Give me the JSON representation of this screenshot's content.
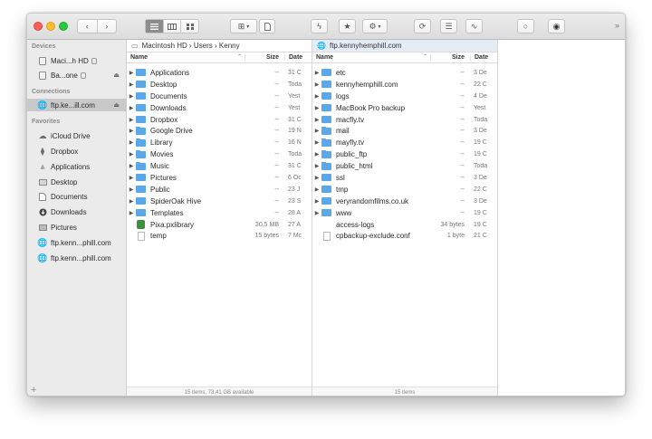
{
  "sidebar": {
    "sections": {
      "devices": "Devices",
      "connections": "Connections",
      "favorites": "Favorites"
    },
    "devices": [
      {
        "label": "Maci...h HD",
        "icon": "disk-icon"
      },
      {
        "label": "Ba...one",
        "icon": "disk-icon"
      }
    ],
    "connections": [
      {
        "label": "ftp.ke...ill.com",
        "icon": "globe-icon"
      }
    ],
    "favorites": [
      {
        "label": "iCloud Drive",
        "icon": "cloud-icon"
      },
      {
        "label": "Dropbox",
        "icon": "dropbox-icon"
      },
      {
        "label": "Applications",
        "icon": "applications-icon"
      },
      {
        "label": "Desktop",
        "icon": "desktop-icon"
      },
      {
        "label": "Documents",
        "icon": "documents-icon"
      },
      {
        "label": "Downloads",
        "icon": "downloads-icon"
      },
      {
        "label": "Pictures",
        "icon": "pictures-icon"
      },
      {
        "label": "ftp.kenn...phill.com",
        "icon": "globe-icon"
      },
      {
        "label": "ftp.kenn...phill.com",
        "icon": "globe-icon"
      }
    ],
    "add_label": "+"
  },
  "left_pane": {
    "path": "Macintosh HD › Users › Kenny",
    "columns": {
      "name": "Name",
      "size": "Size",
      "date": "Date"
    },
    "rows": [
      {
        "name": "Applications",
        "size": "--",
        "date": "31 C",
        "type": "folder"
      },
      {
        "name": "Desktop",
        "size": "--",
        "date": "Toda",
        "type": "folder"
      },
      {
        "name": "Documents",
        "size": "--",
        "date": "Yest",
        "type": "folder"
      },
      {
        "name": "Downloads",
        "size": "--",
        "date": "Yest",
        "type": "folder"
      },
      {
        "name": "Dropbox",
        "size": "--",
        "date": "31 C",
        "type": "folder"
      },
      {
        "name": "Google Drive",
        "size": "--",
        "date": "19 N",
        "type": "folder"
      },
      {
        "name": "Library",
        "size": "--",
        "date": "16 N",
        "type": "folder"
      },
      {
        "name": "Movies",
        "size": "--",
        "date": "Toda",
        "type": "folder"
      },
      {
        "name": "Music",
        "size": "--",
        "date": "31 C",
        "type": "folder"
      },
      {
        "name": "Pictures",
        "size": "--",
        "date": "6 Oc",
        "type": "folder"
      },
      {
        "name": "Public",
        "size": "--",
        "date": "23 J",
        "type": "folder"
      },
      {
        "name": "SpiderOak Hive",
        "size": "--",
        "date": "23 S",
        "type": "folder"
      },
      {
        "name": "Templates",
        "size": "--",
        "date": "28 A",
        "type": "folder"
      },
      {
        "name": "Pixa.pxlibrary",
        "size": "30.5 MB",
        "date": "27 A",
        "type": "pixa"
      },
      {
        "name": "temp",
        "size": "15 bytes",
        "date": "7 Mc",
        "type": "doc"
      }
    ],
    "status": "15 items, 73.41 GB available"
  },
  "right_pane": {
    "path": "ftp.kennyhemphill.com",
    "columns": {
      "name": "Name",
      "size": "Size",
      "date": "Date"
    },
    "rows": [
      {
        "name": "etc",
        "size": "--",
        "date": "3 De",
        "type": "folder"
      },
      {
        "name": "kennyhemphill.com",
        "size": "--",
        "date": "22 C",
        "type": "folder"
      },
      {
        "name": "logs",
        "size": "--",
        "date": "4 De",
        "type": "folder"
      },
      {
        "name": "MacBook Pro backup",
        "size": "--",
        "date": "Yest",
        "type": "folder"
      },
      {
        "name": "macfly.tv",
        "size": "--",
        "date": "Toda",
        "type": "folder"
      },
      {
        "name": "mail",
        "size": "--",
        "date": "3 De",
        "type": "folder"
      },
      {
        "name": "mayfly.tv",
        "size": "--",
        "date": "19 C",
        "type": "folder"
      },
      {
        "name": "public_ftp",
        "size": "--",
        "date": "19 C",
        "type": "folder"
      },
      {
        "name": "public_html",
        "size": "--",
        "date": "Toda",
        "type": "folder"
      },
      {
        "name": "ssl",
        "size": "--",
        "date": "3 De",
        "type": "folder"
      },
      {
        "name": "tmp",
        "size": "--",
        "date": "22 C",
        "type": "folder"
      },
      {
        "name": "veryrandomfilms.co.uk",
        "size": "--",
        "date": "3 De",
        "type": "folder"
      },
      {
        "name": "www",
        "size": "--",
        "date": "19 C",
        "type": "folder"
      },
      {
        "name": "access-logs",
        "size": "34 bytes",
        "date": "19 C",
        "type": "link"
      },
      {
        "name": "cpbackup-exclude.conf",
        "size": "1 byte",
        "date": "21 C",
        "type": "doc"
      }
    ],
    "status": "15 items"
  },
  "icons": {
    "back": "‹",
    "forward": "›",
    "disclosure": "▶",
    "eject": "⏏",
    "overflow": "»",
    "sort": "⌃"
  }
}
